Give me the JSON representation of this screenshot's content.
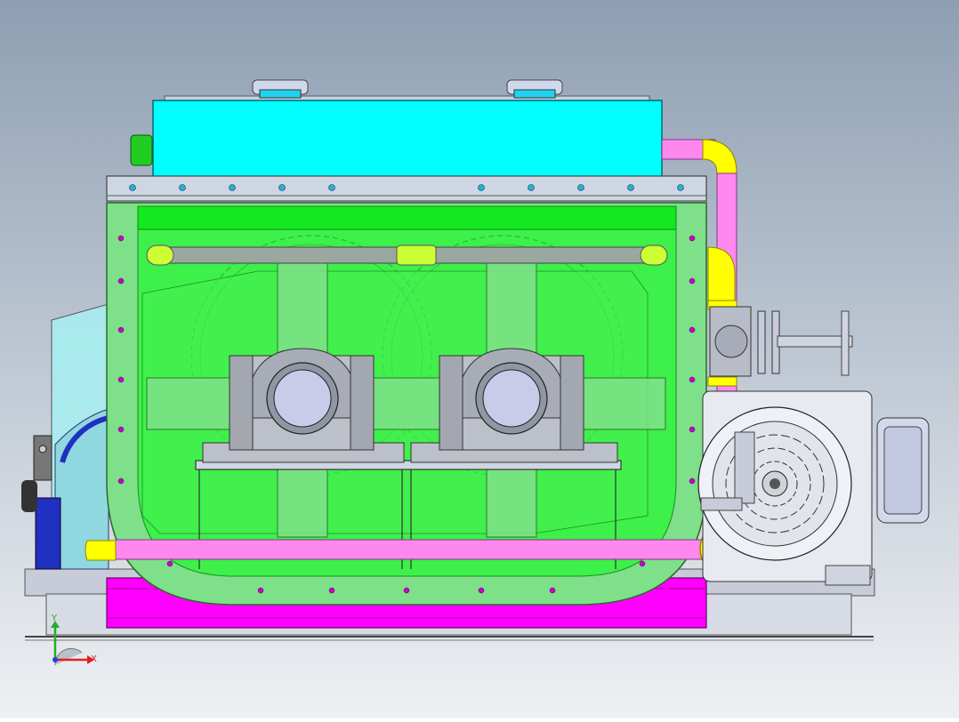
{
  "viewport": {
    "background_top": "#8e9fb3",
    "background_bottom": "#eef0f3"
  },
  "triad": {
    "x_label": "X",
    "y_label": "Y",
    "x_color": "#e02020",
    "y_color": "#20b020",
    "z_color": "#2040e0"
  },
  "colors": {
    "tank_body": "#3df04a",
    "tank_frame": "#7fe08a",
    "tank_top_band": "#14e820",
    "cover": "#00ffff",
    "flange_plate": "#cfd6e3",
    "base_skid": "#ff00ff",
    "pipe_pink": "#ff88ee",
    "pipe_yellow": "#ffff00",
    "bearing": "#bcc0c8",
    "motor": "#e8eaf2",
    "bolt_dot": "#cc00cc",
    "bolt_blue": "#1db4d8"
  },
  "components": [
    "mixing-tank",
    "top-cover",
    "bearing-housing-left",
    "bearing-housing-right",
    "drive-gear-left",
    "drive-gear-right",
    "electric-motor",
    "gearbox-left",
    "inlet-valve",
    "base-frame",
    "steam-pipe"
  ]
}
